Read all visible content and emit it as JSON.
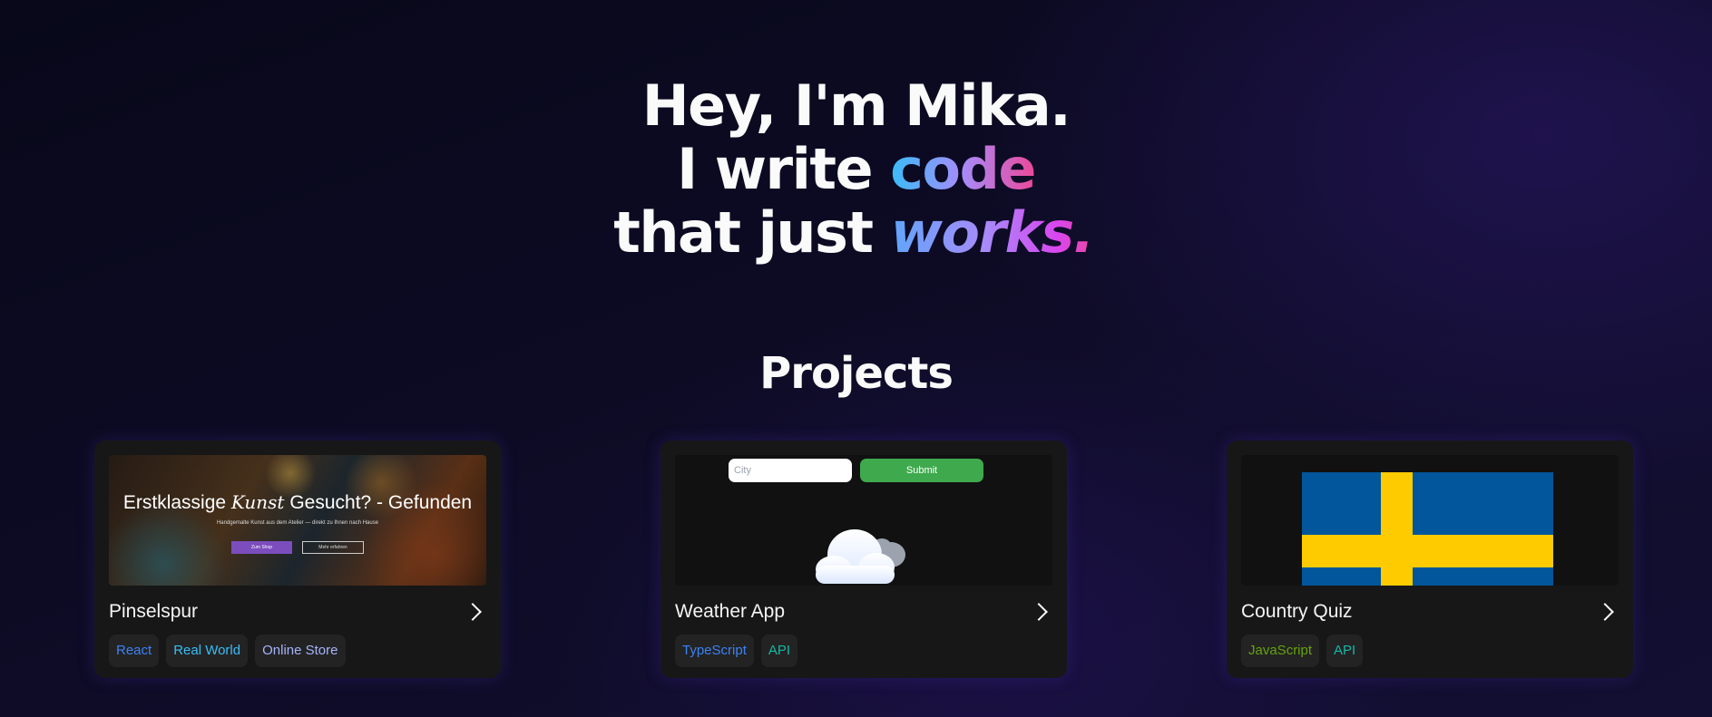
{
  "hero": {
    "line1": "Hey, I'm Mika.",
    "line2_prefix": "I write ",
    "line2_highlight": "code",
    "line3_prefix": "that just ",
    "line3_highlight": "works",
    "line3_suffix": "."
  },
  "projects": {
    "heading": "Projects",
    "cards": [
      {
        "title": "Pinselspur",
        "thumb": {
          "heading_before": "Erstklassige ",
          "heading_script": "Kunst",
          "heading_after": " Gesucht? - Gefunden",
          "subtext": "Handgemalte Kunst aus dem Atelier — direkt zu Ihnen nach Hause",
          "primary_button": "Zum Shop",
          "secondary_button": "Mehr erfahren"
        },
        "tags": [
          {
            "label": "React",
            "color": "#3b82f6"
          },
          {
            "label": "Real World",
            "color": "#38bdf8"
          },
          {
            "label": "Online Store",
            "color": "#a5b4fc"
          }
        ]
      },
      {
        "title": "Weather App",
        "thumb": {
          "input_placeholder": "City",
          "submit_label": "Submit",
          "icon": "cloud-icon"
        },
        "tags": [
          {
            "label": "TypeScript",
            "color": "#3b82f6"
          },
          {
            "label": "API",
            "color": "#14b8a6"
          }
        ]
      },
      {
        "title": "Country Quiz",
        "thumb": {
          "icon": "sweden-flag",
          "flag_blue": "#02569b",
          "flag_yellow": "#fecb00"
        },
        "tags": [
          {
            "label": "JavaScript",
            "color": "#65a30d"
          },
          {
            "label": "API",
            "color": "#14b8a6"
          }
        ]
      }
    ]
  },
  "colors": {
    "background": "#0b0a1c",
    "card": "#171717",
    "tag_bg": "#232323",
    "gradient": [
      "#38bdf8",
      "#a78bfa",
      "#ec4899"
    ]
  }
}
